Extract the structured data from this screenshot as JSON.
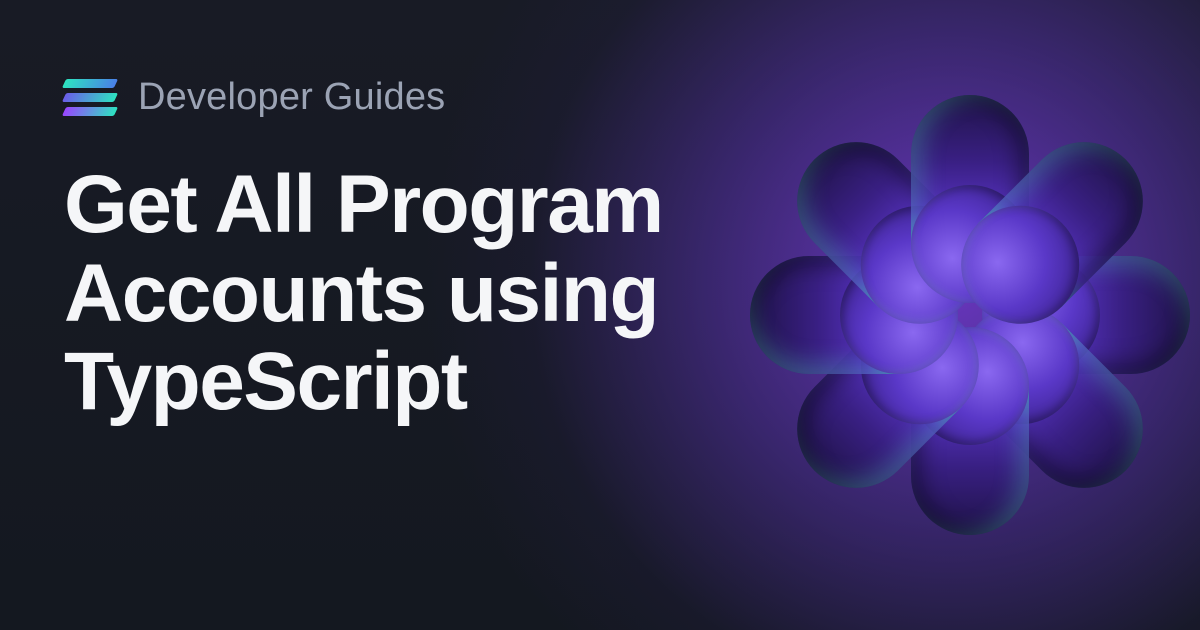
{
  "header": {
    "category": "Developer Guides"
  },
  "title": "Get All Program Accounts using TypeScript",
  "brand": {
    "colors": {
      "gradient_start": "#9945ff",
      "gradient_end": "#2de3c0",
      "text_muted": "#9ba3b4",
      "text_primary": "#f5f6f8"
    }
  },
  "art": {
    "cylinder_count": 8,
    "icon": "cylinder-ring-icon"
  }
}
